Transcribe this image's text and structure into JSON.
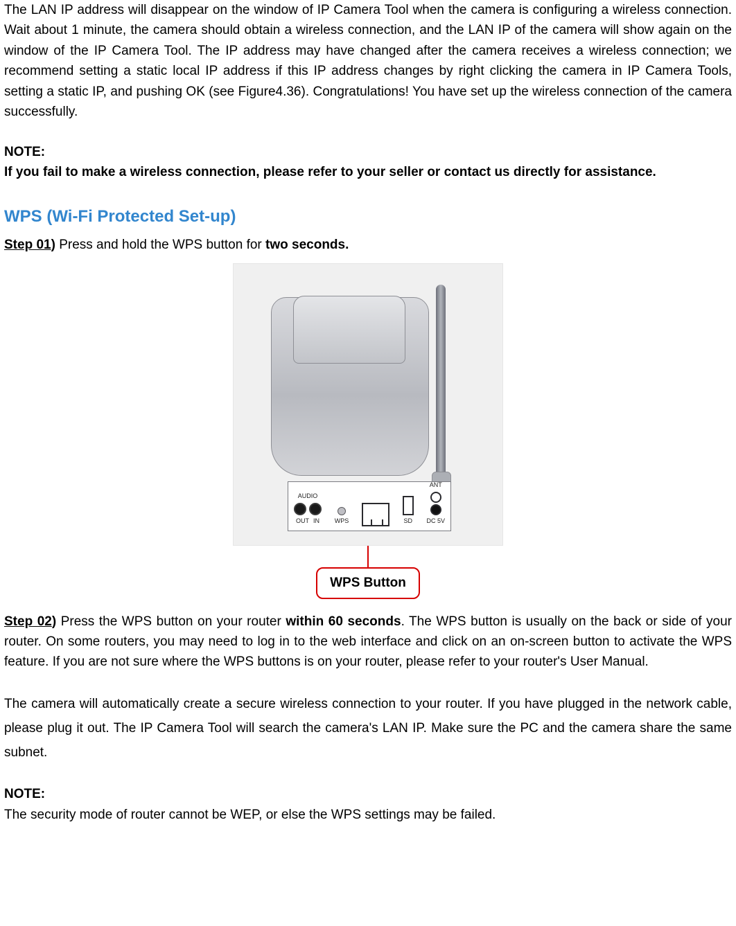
{
  "intro": {
    "paragraph1": "The LAN IP address will disappear on the window of IP Camera Tool when the camera is configuring a wireless connection. Wait about 1 minute, the camera should obtain a wireless connection, and the LAN IP of the camera will show again on the window of the IP Camera Tool. The IP address may have changed after the camera receives a wireless connection; we recommend setting a static local IP address if this IP address changes by right clicking the camera in IP Camera Tools, setting a static IP, and pushing OK (see Figure4.36). Congratulations! You have set up the wireless connection of the camera successfully."
  },
  "note1": {
    "label": "NOTE:",
    "body": "If you fail to make a wireless connection, please refer to your seller or contact us directly for assistance."
  },
  "section": {
    "heading": "WPS (Wi-Fi Protected Set-up)"
  },
  "step01": {
    "label": "Step 01",
    "paren": ")",
    "text_before_bold": " Press and hold the WPS button for ",
    "bold": "two seconds."
  },
  "figure": {
    "port_labels": {
      "audio": "AUDIO",
      "out": "OUT",
      "in": "IN",
      "wps": "WPS",
      "sd": "SD",
      "ant": "ANT",
      "dc": "DC 5V"
    },
    "callout": "WPS Button"
  },
  "step02": {
    "label": "Step 02",
    "paren": ")",
    "text_before_bold": " Press the WPS button on your router ",
    "bold": "within 60 seconds",
    "text_after_bold": ". The WPS button is usually on the back or side of your router. On some routers, you may need to log in to the web interface and click on an on-screen button to activate the WPS feature. If you are not sure where the WPS buttons is on your router, please refer to your router's User Manual."
  },
  "paragraph_after_step02": "The camera will automatically create a secure wireless connection to your router. If you have plugged in the network cable, please plug it out. The IP Camera Tool will search the camera's LAN IP. Make sure the PC and the camera share the same subnet.",
  "note2": {
    "label": "NOTE:",
    "body": "The security mode of router cannot be WEP, or else the WPS settings may be failed."
  }
}
